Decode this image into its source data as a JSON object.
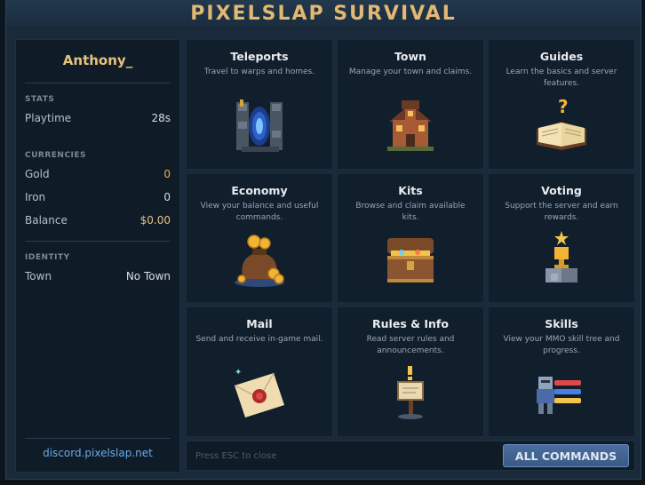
{
  "window": {
    "title": "PIXELSLAP SURVIVAL"
  },
  "sidebar": {
    "player_name": "Anthony_",
    "stats": {
      "label": "STATS",
      "playtime_label": "Playtime",
      "playtime_value": "28s"
    },
    "currencies": {
      "label": "CURRENCIES",
      "gold_label": "Gold",
      "gold_value": "0",
      "iron_label": "Iron",
      "iron_value": "0",
      "balance_label": "Balance",
      "balance_value": "$0.00"
    },
    "identity": {
      "label": "IDENTITY",
      "town_label": "Town",
      "town_value": "No Town"
    },
    "discord_link": "discord.pixelslap.net"
  },
  "cards": [
    {
      "title": "Teleports",
      "description": "Travel to warps and homes.",
      "icon": "portal-icon"
    },
    {
      "title": "Town",
      "description": "Manage your town and claims.",
      "icon": "house-icon"
    },
    {
      "title": "Guides",
      "description": "Learn the basics and server features.",
      "icon": "book-icon"
    },
    {
      "title": "Economy",
      "description": "View your balance and useful commands.",
      "icon": "coin-bag-icon"
    },
    {
      "title": "Kits",
      "description": "Browse and claim available kits.",
      "icon": "treasure-chest-icon"
    },
    {
      "title": "Voting",
      "description": "Support the server and earn rewards.",
      "icon": "trophy-icon"
    },
    {
      "title": "Mail",
      "description": "Send and receive in-game mail.",
      "icon": "envelope-icon"
    },
    {
      "title": "Rules & Info",
      "description": "Read server rules and announcements.",
      "icon": "signpost-icon"
    },
    {
      "title": "Skills",
      "description": "View your MMO skill tree and progress.",
      "icon": "knight-skills-icon"
    }
  ],
  "footer": {
    "hint": "Press ESC to close",
    "all_commands_label": "ALL COMMANDS"
  },
  "colors": {
    "accent_gold": "#e7c27d",
    "link_blue": "#6aa9ea",
    "button_blue": "#4b6e9e"
  }
}
